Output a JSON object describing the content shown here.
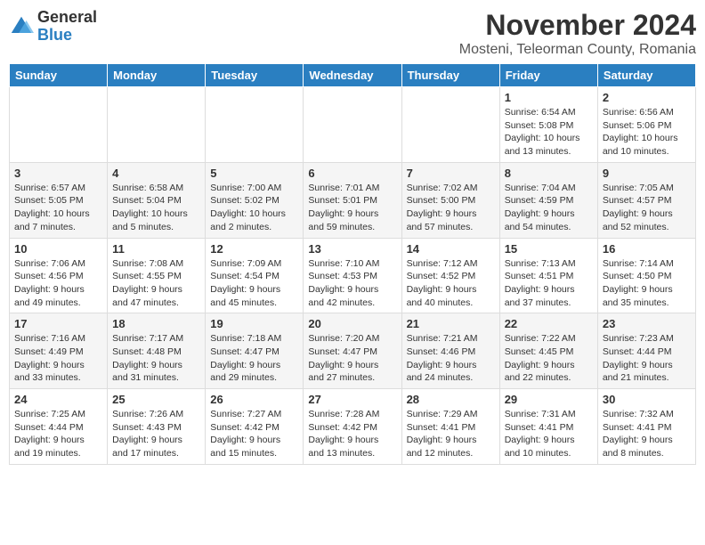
{
  "header": {
    "logo_general": "General",
    "logo_blue": "Blue",
    "month_title": "November 2024",
    "location": "Mosteni, Teleorman County, Romania"
  },
  "days_of_week": [
    "Sunday",
    "Monday",
    "Tuesday",
    "Wednesday",
    "Thursday",
    "Friday",
    "Saturday"
  ],
  "weeks": [
    [
      {
        "day": "",
        "info": ""
      },
      {
        "day": "",
        "info": ""
      },
      {
        "day": "",
        "info": ""
      },
      {
        "day": "",
        "info": ""
      },
      {
        "day": "",
        "info": ""
      },
      {
        "day": "1",
        "info": "Sunrise: 6:54 AM\nSunset: 5:08 PM\nDaylight: 10 hours and 13 minutes."
      },
      {
        "day": "2",
        "info": "Sunrise: 6:56 AM\nSunset: 5:06 PM\nDaylight: 10 hours and 10 minutes."
      }
    ],
    [
      {
        "day": "3",
        "info": "Sunrise: 6:57 AM\nSunset: 5:05 PM\nDaylight: 10 hours and 7 minutes."
      },
      {
        "day": "4",
        "info": "Sunrise: 6:58 AM\nSunset: 5:04 PM\nDaylight: 10 hours and 5 minutes."
      },
      {
        "day": "5",
        "info": "Sunrise: 7:00 AM\nSunset: 5:02 PM\nDaylight: 10 hours and 2 minutes."
      },
      {
        "day": "6",
        "info": "Sunrise: 7:01 AM\nSunset: 5:01 PM\nDaylight: 9 hours and 59 minutes."
      },
      {
        "day": "7",
        "info": "Sunrise: 7:02 AM\nSunset: 5:00 PM\nDaylight: 9 hours and 57 minutes."
      },
      {
        "day": "8",
        "info": "Sunrise: 7:04 AM\nSunset: 4:59 PM\nDaylight: 9 hours and 54 minutes."
      },
      {
        "day": "9",
        "info": "Sunrise: 7:05 AM\nSunset: 4:57 PM\nDaylight: 9 hours and 52 minutes."
      }
    ],
    [
      {
        "day": "10",
        "info": "Sunrise: 7:06 AM\nSunset: 4:56 PM\nDaylight: 9 hours and 49 minutes."
      },
      {
        "day": "11",
        "info": "Sunrise: 7:08 AM\nSunset: 4:55 PM\nDaylight: 9 hours and 47 minutes."
      },
      {
        "day": "12",
        "info": "Sunrise: 7:09 AM\nSunset: 4:54 PM\nDaylight: 9 hours and 45 minutes."
      },
      {
        "day": "13",
        "info": "Sunrise: 7:10 AM\nSunset: 4:53 PM\nDaylight: 9 hours and 42 minutes."
      },
      {
        "day": "14",
        "info": "Sunrise: 7:12 AM\nSunset: 4:52 PM\nDaylight: 9 hours and 40 minutes."
      },
      {
        "day": "15",
        "info": "Sunrise: 7:13 AM\nSunset: 4:51 PM\nDaylight: 9 hours and 37 minutes."
      },
      {
        "day": "16",
        "info": "Sunrise: 7:14 AM\nSunset: 4:50 PM\nDaylight: 9 hours and 35 minutes."
      }
    ],
    [
      {
        "day": "17",
        "info": "Sunrise: 7:16 AM\nSunset: 4:49 PM\nDaylight: 9 hours and 33 minutes."
      },
      {
        "day": "18",
        "info": "Sunrise: 7:17 AM\nSunset: 4:48 PM\nDaylight: 9 hours and 31 minutes."
      },
      {
        "day": "19",
        "info": "Sunrise: 7:18 AM\nSunset: 4:47 PM\nDaylight: 9 hours and 29 minutes."
      },
      {
        "day": "20",
        "info": "Sunrise: 7:20 AM\nSunset: 4:47 PM\nDaylight: 9 hours and 27 minutes."
      },
      {
        "day": "21",
        "info": "Sunrise: 7:21 AM\nSunset: 4:46 PM\nDaylight: 9 hours and 24 minutes."
      },
      {
        "day": "22",
        "info": "Sunrise: 7:22 AM\nSunset: 4:45 PM\nDaylight: 9 hours and 22 minutes."
      },
      {
        "day": "23",
        "info": "Sunrise: 7:23 AM\nSunset: 4:44 PM\nDaylight: 9 hours and 21 minutes."
      }
    ],
    [
      {
        "day": "24",
        "info": "Sunrise: 7:25 AM\nSunset: 4:44 PM\nDaylight: 9 hours and 19 minutes."
      },
      {
        "day": "25",
        "info": "Sunrise: 7:26 AM\nSunset: 4:43 PM\nDaylight: 9 hours and 17 minutes."
      },
      {
        "day": "26",
        "info": "Sunrise: 7:27 AM\nSunset: 4:42 PM\nDaylight: 9 hours and 15 minutes."
      },
      {
        "day": "27",
        "info": "Sunrise: 7:28 AM\nSunset: 4:42 PM\nDaylight: 9 hours and 13 minutes."
      },
      {
        "day": "28",
        "info": "Sunrise: 7:29 AM\nSunset: 4:41 PM\nDaylight: 9 hours and 12 minutes."
      },
      {
        "day": "29",
        "info": "Sunrise: 7:31 AM\nSunset: 4:41 PM\nDaylight: 9 hours and 10 minutes."
      },
      {
        "day": "30",
        "info": "Sunrise: 7:32 AM\nSunset: 4:41 PM\nDaylight: 9 hours and 8 minutes."
      }
    ]
  ]
}
